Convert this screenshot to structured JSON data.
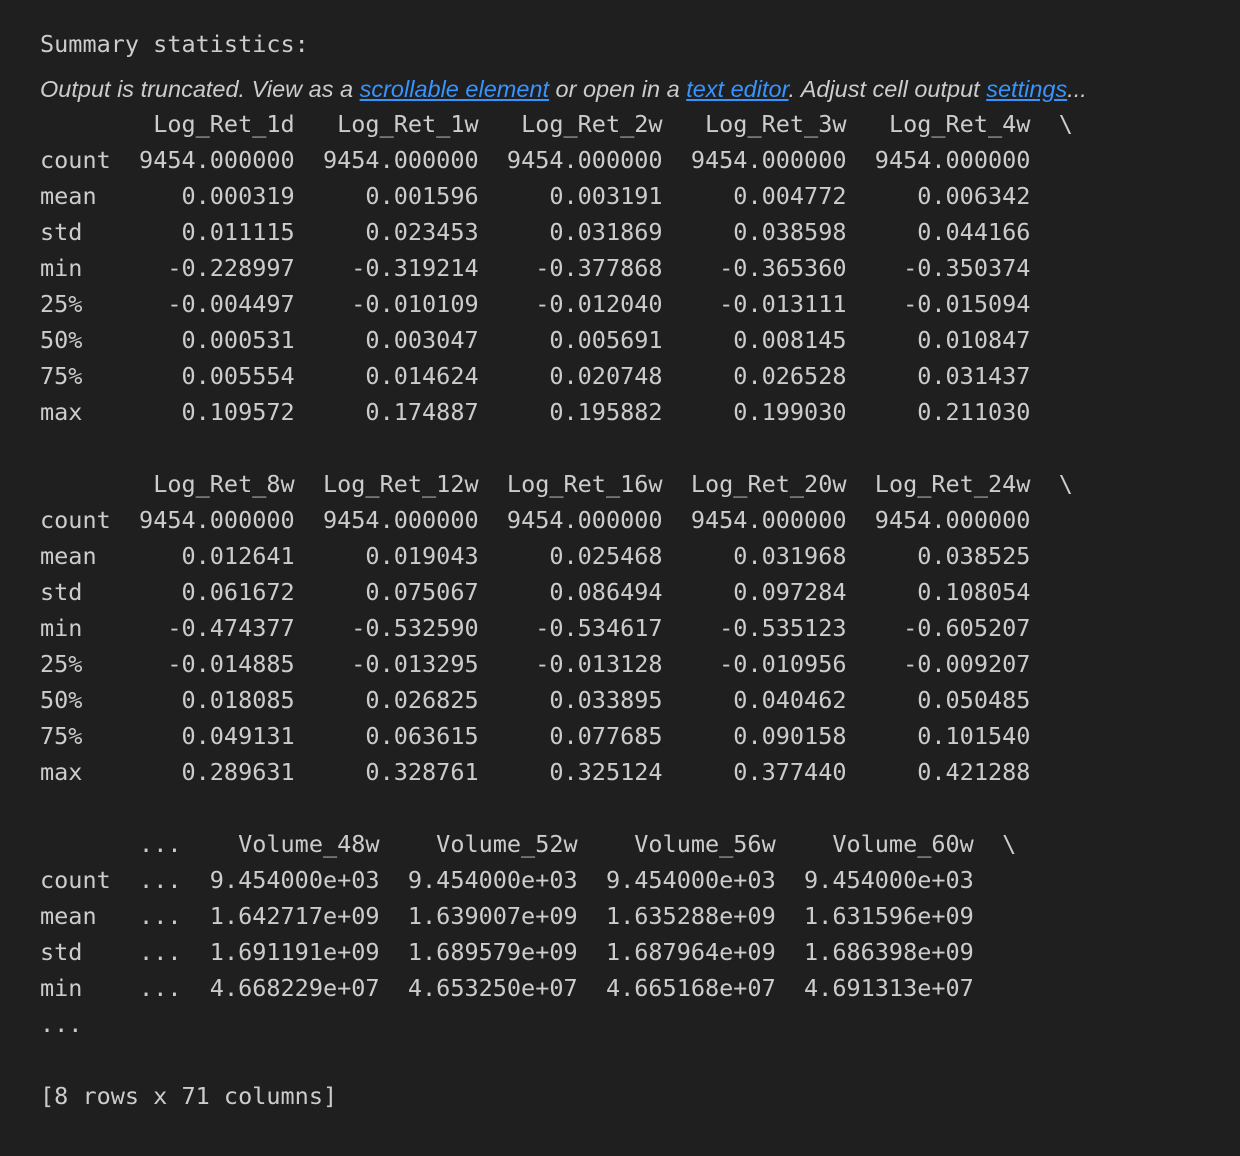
{
  "heading": "Summary statistics:",
  "notice": {
    "prefix": "Output is truncated. View as a ",
    "link_scrollable": "scrollable element",
    "middle": " or open in a ",
    "link_text_editor": "text editor",
    "middle2": ". Adjust cell output ",
    "link_settings": "settings",
    "suffix": "..."
  },
  "table_blocks": [
    {
      "columns": [
        "Log_Ret_1d",
        "Log_Ret_1w",
        "Log_Ret_2w",
        "Log_Ret_3w",
        "Log_Ret_4w"
      ],
      "continuation": "\\",
      "rows": [
        {
          "label": "count",
          "values": [
            "9454.000000",
            "9454.000000",
            "9454.000000",
            "9454.000000",
            "9454.000000"
          ]
        },
        {
          "label": "mean",
          "values": [
            "0.000319",
            "0.001596",
            "0.003191",
            "0.004772",
            "0.006342"
          ]
        },
        {
          "label": "std",
          "values": [
            "0.011115",
            "0.023453",
            "0.031869",
            "0.038598",
            "0.044166"
          ]
        },
        {
          "label": "min",
          "values": [
            "-0.228997",
            "-0.319214",
            "-0.377868",
            "-0.365360",
            "-0.350374"
          ]
        },
        {
          "label": "25%",
          "values": [
            "-0.004497",
            "-0.010109",
            "-0.012040",
            "-0.013111",
            "-0.015094"
          ]
        },
        {
          "label": "50%",
          "values": [
            "0.000531",
            "0.003047",
            "0.005691",
            "0.008145",
            "0.010847"
          ]
        },
        {
          "label": "75%",
          "values": [
            "0.005554",
            "0.014624",
            "0.020748",
            "0.026528",
            "0.031437"
          ]
        },
        {
          "label": "max",
          "values": [
            "0.109572",
            "0.174887",
            "0.195882",
            "0.199030",
            "0.211030"
          ]
        }
      ]
    },
    {
      "columns": [
        "Log_Ret_8w",
        "Log_Ret_12w",
        "Log_Ret_16w",
        "Log_Ret_20w",
        "Log_Ret_24w"
      ],
      "continuation": "\\",
      "rows": [
        {
          "label": "count",
          "values": [
            "9454.000000",
            "9454.000000",
            "9454.000000",
            "9454.000000",
            "9454.000000"
          ]
        },
        {
          "label": "mean",
          "values": [
            "0.012641",
            "0.019043",
            "0.025468",
            "0.031968",
            "0.038525"
          ]
        },
        {
          "label": "std",
          "values": [
            "0.061672",
            "0.075067",
            "0.086494",
            "0.097284",
            "0.108054"
          ]
        },
        {
          "label": "min",
          "values": [
            "-0.474377",
            "-0.532590",
            "-0.534617",
            "-0.535123",
            "-0.605207"
          ]
        },
        {
          "label": "25%",
          "values": [
            "-0.014885",
            "-0.013295",
            "-0.013128",
            "-0.010956",
            "-0.009207"
          ]
        },
        {
          "label": "50%",
          "values": [
            "0.018085",
            "0.026825",
            "0.033895",
            "0.040462",
            "0.050485"
          ]
        },
        {
          "label": "75%",
          "values": [
            "0.049131",
            "0.063615",
            "0.077685",
            "0.090158",
            "0.101540"
          ]
        },
        {
          "label": "max",
          "values": [
            "0.289631",
            "0.328761",
            "0.325124",
            "0.377440",
            "0.421288"
          ]
        }
      ]
    },
    {
      "columns": [
        "...",
        "Volume_48w",
        "Volume_52w",
        "Volume_56w",
        "Volume_60w"
      ],
      "continuation": "\\",
      "rows": [
        {
          "label": "count",
          "values": [
            "...",
            "9.454000e+03",
            "9.454000e+03",
            "9.454000e+03",
            "9.454000e+03"
          ]
        },
        {
          "label": "mean",
          "values": [
            "...",
            "1.642717e+09",
            "1.639007e+09",
            "1.635288e+09",
            "1.631596e+09"
          ]
        },
        {
          "label": "std",
          "values": [
            "...",
            "1.691191e+09",
            "1.689579e+09",
            "1.687964e+09",
            "1.686398e+09"
          ]
        },
        {
          "label": "min",
          "values": [
            "...",
            "4.668229e+07",
            "4.653250e+07",
            "4.665168e+07",
            "4.691313e+07"
          ]
        }
      ],
      "trailing": "..."
    }
  ],
  "shape_summary": "[8 rows x 71 columns]"
}
